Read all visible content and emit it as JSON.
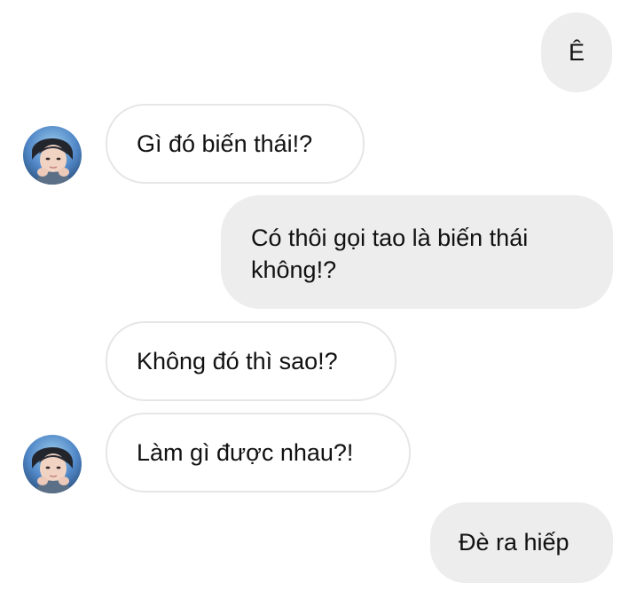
{
  "conversation": {
    "messages": [
      {
        "sender": "me",
        "text": "Ê"
      },
      {
        "sender": "other",
        "text": "Gì đó biến thái!?"
      },
      {
        "sender": "me",
        "lines": [
          "Có thôi gọi tao là biến thái",
          "không!?"
        ]
      },
      {
        "sender": "other",
        "text": "Không đó thì sao!?"
      },
      {
        "sender": "other",
        "text": "Làm gì được nhau?!"
      },
      {
        "sender": "me",
        "text": "Đè ra hiếp"
      }
    ]
  },
  "colors": {
    "sent_bubble": "#ededed",
    "received_border": "#e6e6e6",
    "text": "#111111"
  },
  "icons": {
    "avatar": "contact-avatar-icon"
  }
}
